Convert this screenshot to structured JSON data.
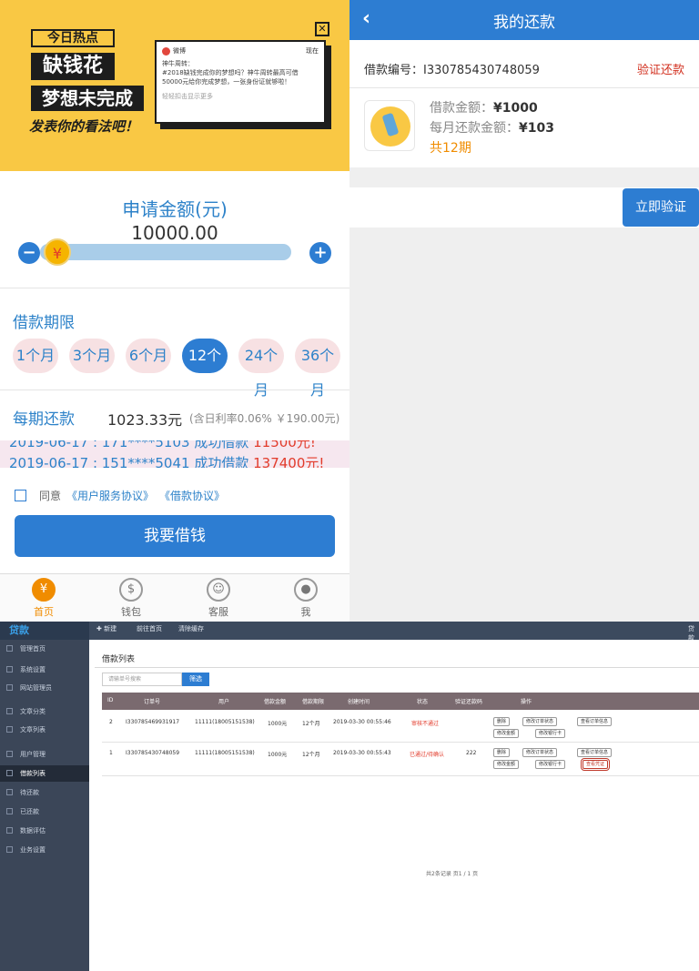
{
  "left_app": {
    "banner": {
      "hot_tag": "今日热点",
      "line1": "缺钱花",
      "line2": "梦想未完成",
      "slogan": "发表你的看法吧！",
      "card": {
        "source": "微博",
        "time": "现在",
        "line1": "神牛周转：",
        "line2": "#2018缺钱完成你的梦想吗？神牛周转最高可借",
        "line3": "50000元给你完成梦想，一张身份证就够啦！",
        "more": "轻轻扣击显示更多"
      }
    },
    "amount": {
      "title": "申请金额(元)",
      "value": "10000.00",
      "thumb_symbol": "¥",
      "minus": "−",
      "plus": "+",
      "level": 0.05
    },
    "term": {
      "title": "借款期限",
      "options": [
        "1个月",
        "3个月",
        "6个月",
        "12个月",
        "24个月",
        "36个月"
      ],
      "selected": "12个月"
    },
    "payment": {
      "label": "每期还款",
      "value": "1023.33元",
      "note": "(含日利率0.06% ￥190.00元)"
    },
    "ticker": {
      "line1_prefix": "2019-06-17 : 171****5103 成功借款 ",
      "line1_amount": "11500元!",
      "line2_prefix": "2019-06-17 : 151****5041 成功借款 ",
      "line2_amount": "137400元!"
    },
    "agreement": {
      "text": "同意",
      "link1": "《用户服务协议》",
      "link2": "《借款协议》"
    },
    "borrow_button": "我要借钱",
    "tabs": [
      "首页",
      "钱包",
      "客服",
      "我"
    ]
  },
  "right_app": {
    "header_title": "我的还款",
    "loan_no": "借款编号：I330785430748059",
    "verify_link": "验证还款",
    "amount_label": "借款金额：",
    "amount_value": "¥1000",
    "monthly_label": "每月还款金额：",
    "monthly_value": "¥103",
    "periods": "共12期",
    "verify_button": "立即验证"
  },
  "admin": {
    "brand": "贷款",
    "top_nav": [
      "✚ 新建",
      "前往首页",
      "清除缓存"
    ],
    "corner": "贷款",
    "sidebar": [
      "管理首页",
      "系统设置",
      "网站管理员",
      "文章分类",
      "文章列表",
      "用户管理",
      "借款列表",
      "待还款",
      "已还款",
      "数据评估",
      "业务设置"
    ],
    "active_sidebar": "借款列表",
    "content_title": "借款列表",
    "search_placeholder": "请输单号搜索",
    "search_button": "筛选",
    "columns": [
      "ID",
      "订单号",
      "用户",
      "借款金额",
      "借款期限",
      "创建时间",
      "状态",
      "验证还款码",
      "操作"
    ],
    "rows": [
      {
        "id": "2",
        "order": "I330785469931917",
        "user": "11111(18005151538)",
        "amount": "1000元",
        "term": "12个月",
        "created": "2019-03-30 00:55:46",
        "status": "审核不通过",
        "code": ""
      },
      {
        "id": "1",
        "order": "I330785430748059",
        "user": "11111(18005151538)",
        "amount": "1000元",
        "term": "12个月",
        "created": "2019-03-30 00:55:43",
        "status": "已通过/待确认",
        "code": "222"
      }
    ],
    "ops": [
      "删除",
      "修改订单状态",
      "查看订单信息",
      "修改金额",
      "修改银行卡"
    ],
    "highlight_op": "查看凭证",
    "footer": "共2条记录 页1 / 1 页"
  }
}
